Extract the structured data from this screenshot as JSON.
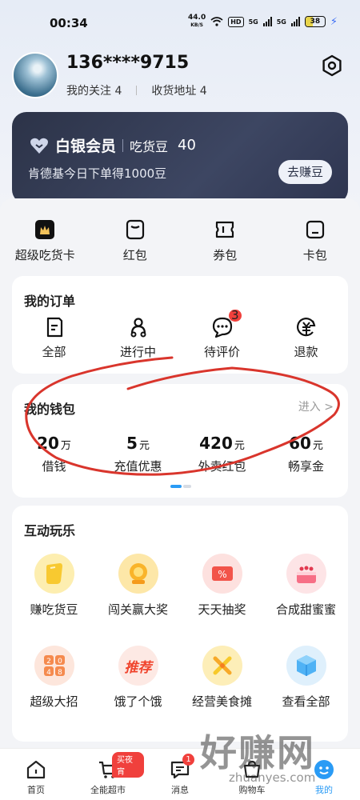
{
  "status_bar": {
    "time": "00:34",
    "net_speed": "44.0",
    "net_unit": "KB/S",
    "hd_label": "HD",
    "signal1": "5G",
    "signal2": "5G",
    "battery": "38"
  },
  "profile": {
    "phone": "136****9715",
    "follow_label": "我的关注 4",
    "address_label": "收货地址 4"
  },
  "vip": {
    "level": "白银会员",
    "bean_label": "吃货豆",
    "bean_count": "40",
    "desc": "肯德基今日下单得1000豆",
    "earn_button": "去赚豆"
  },
  "quick_menu": [
    {
      "label": "超级吃货卡",
      "icon": "super-card-icon"
    },
    {
      "label": "红包",
      "icon": "red-packet-icon"
    },
    {
      "label": "券包",
      "icon": "coupon-icon"
    },
    {
      "label": "卡包",
      "icon": "card-wallet-icon"
    }
  ],
  "orders": {
    "title": "我的订单",
    "items": [
      {
        "label": "全部",
        "icon": "all-orders-icon"
      },
      {
        "label": "进行中",
        "icon": "delivery-icon"
      },
      {
        "label": "待评价",
        "icon": "comment-icon",
        "badge": "3"
      },
      {
        "label": "退款",
        "icon": "refund-icon"
      }
    ]
  },
  "wallet": {
    "title": "我的钱包",
    "enter_label": "进入 >",
    "items": [
      {
        "value": "20",
        "unit": "万",
        "label": "借钱"
      },
      {
        "value": "5",
        "unit": "元",
        "label": "充值优惠"
      },
      {
        "value": "420",
        "unit": "元",
        "label": "外卖红包"
      },
      {
        "value": "60",
        "unit": "元",
        "label": "畅享金"
      }
    ]
  },
  "fun": {
    "title": "互动玩乐",
    "items": [
      {
        "label": "赚吃货豆",
        "icon": "bean-icon",
        "color": "#fdeeb0"
      },
      {
        "label": "闯关赢大奖",
        "icon": "prize-icon",
        "color": "#fde7a8"
      },
      {
        "label": "天天抽奖",
        "icon": "lottery-ticket-icon",
        "color": "#fde1df"
      },
      {
        "label": "合成甜蜜蜜",
        "icon": "cake-icon",
        "color": "#fde4e6"
      },
      {
        "label": "超级大招",
        "icon": "game-2048-icon",
        "color": "#fde6dc",
        "glyph": "2048"
      },
      {
        "label": "饿了个饿",
        "icon": "recommend-icon",
        "color": "#fde9e4",
        "glyph": "推荐"
      },
      {
        "label": "经营美食摊",
        "icon": "food-stall-icon",
        "color": "#fdeeb8"
      },
      {
        "label": "查看全部",
        "icon": "view-all-icon",
        "color": "#dff0fc"
      }
    ]
  },
  "tabbar": [
    {
      "label": "首页",
      "icon": "home-icon"
    },
    {
      "label": "全能超市",
      "icon": "supermarket-icon",
      "tag": "买夜宵"
    },
    {
      "label": "消息",
      "icon": "message-icon",
      "badge": "1"
    },
    {
      "label": "购物车",
      "icon": "cart-icon"
    },
    {
      "label": "我的",
      "icon": "profile-icon",
      "active": true
    }
  ],
  "watermark": {
    "text": "好赚网",
    "url": "zhuanyes.com"
  },
  "colors": {
    "accent": "#2a9bf5",
    "badge_red": "#f0403c",
    "vip_bg": "#2c3348"
  }
}
